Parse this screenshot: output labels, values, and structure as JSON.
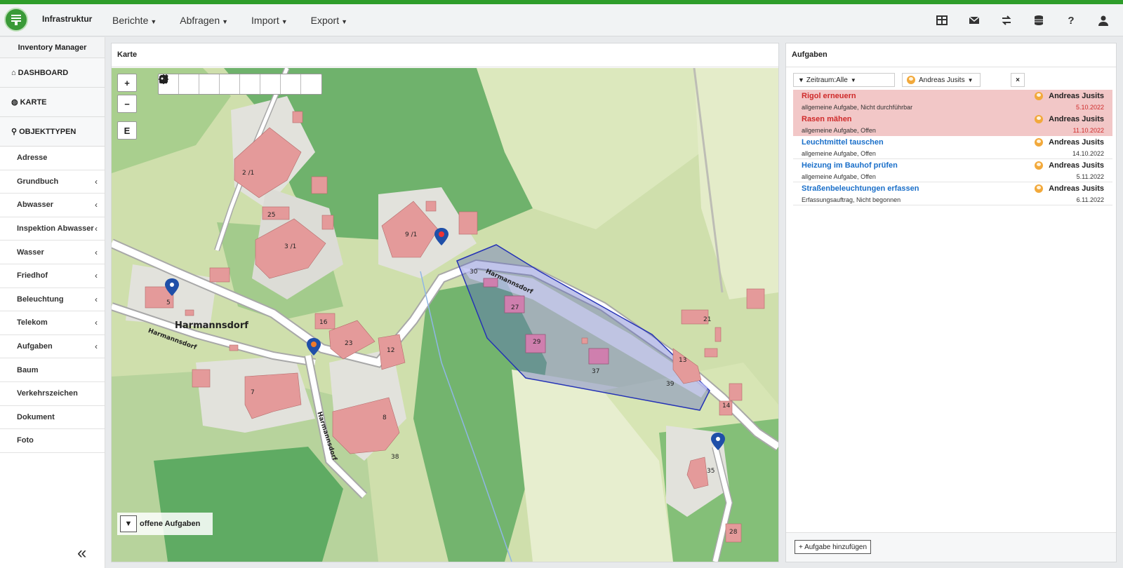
{
  "app": {
    "title": "Infrastruktur",
    "brand_color": "#2e9d2a"
  },
  "menu": [
    {
      "label": "Berichte"
    },
    {
      "label": "Abfragen"
    },
    {
      "label": "Import"
    },
    {
      "label": "Export"
    }
  ],
  "top_icons": [
    "table-icon",
    "mail-icon",
    "swap-icon",
    "database-icon",
    "help-icon",
    "user-icon"
  ],
  "sidebar": {
    "header": "Inventory Manager",
    "main": [
      {
        "label": "DASHBOARD",
        "icon": "home-icon"
      },
      {
        "label": "KARTE",
        "icon": "globe-icon"
      },
      {
        "label": "OBJEKTTYPEN",
        "icon": "search-icon"
      }
    ],
    "items": [
      {
        "label": "Adresse",
        "chevron": ""
      },
      {
        "label": "Grundbuch",
        "chevron": "‹"
      },
      {
        "label": "Abwasser",
        "chevron": "‹"
      },
      {
        "label": "Inspektion Abwasser",
        "chevron": "‹"
      },
      {
        "label": "Wasser",
        "chevron": "‹"
      },
      {
        "label": "Friedhof",
        "chevron": "‹"
      },
      {
        "label": "Beleuchtung",
        "chevron": "‹"
      },
      {
        "label": "Telekom",
        "chevron": "‹"
      },
      {
        "label": "Aufgaben",
        "chevron": "‹"
      },
      {
        "label": "Baum",
        "chevron": ""
      },
      {
        "label": "Verkehrszeichen",
        "chevron": ""
      },
      {
        "label": "Dokument",
        "chevron": ""
      },
      {
        "label": "Foto",
        "chevron": ""
      }
    ],
    "collapse": "«"
  },
  "map": {
    "title": "Karte",
    "zoom_in": "+",
    "zoom_out": "−",
    "east_button": "E",
    "toolbar": [
      "layers-icon",
      "basemap-icon",
      "fullscreen-icon",
      "locate-icon",
      "document-icon",
      "target-icon",
      "settings-icon",
      "add-marker-icon"
    ],
    "filter_label": "offene Aufgaben",
    "place_name": "Harmannsdorf",
    "street_labels": [
      "Harmannsdorf",
      "Harmannsdorf",
      "Harmannsdorf"
    ],
    "house_numbers": [
      "2 /1",
      "25",
      "3 /1",
      "9 /1",
      "5",
      "16",
      "23",
      "12",
      "7",
      "8",
      "38",
      "30",
      "27",
      "29",
      "37",
      "13",
      "39",
      "21",
      "14",
      "35",
      "28"
    ]
  },
  "tasks": {
    "title": "Aufgaben",
    "filter_period": "Zeitraum:Alle",
    "filter_user": "Andreas Jusits",
    "clear": "×",
    "items": [
      {
        "name": "Rigol erneuern",
        "desc": "allgemeine Aufgabe, Nicht durchführbar",
        "user": "Andreas Jusits",
        "date": "5.10.2022",
        "overdue": true
      },
      {
        "name": "Rasen mähen",
        "desc": "allgemeine Aufgabe, Offen",
        "user": "Andreas Jusits",
        "date": "11.10.2022",
        "overdue": true
      },
      {
        "name": "Leuchtmittel tauschen",
        "desc": "allgemeine Aufgabe, Offen",
        "user": "Andreas Jusits",
        "date": "14.10.2022",
        "overdue": false
      },
      {
        "name": "Heizung im Bauhof prüfen",
        "desc": "allgemeine Aufgabe, Offen",
        "user": "Andreas Jusits",
        "date": "5.11.2022",
        "overdue": false
      },
      {
        "name": "Straßenbeleuchtungen erfassen",
        "desc": "Erfassungsauftrag, Nicht begonnen",
        "user": "Andreas Jusits",
        "date": "6.11.2022",
        "overdue": false
      }
    ],
    "add_button": "+ Aufgabe hinzufügen"
  }
}
